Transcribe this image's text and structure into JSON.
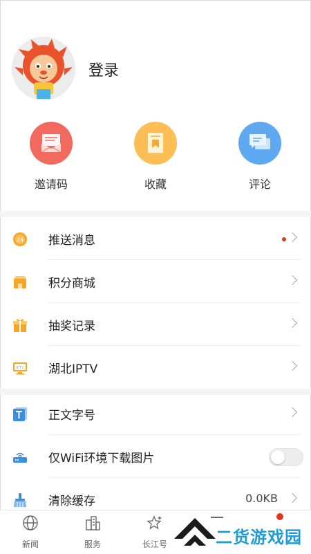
{
  "profile": {
    "login_label": "登录"
  },
  "shortcuts": [
    {
      "label": "邀请码",
      "icon": "envelope-icon",
      "color": "#f26a5e"
    },
    {
      "label": "收藏",
      "icon": "bookmark-icon",
      "color": "#fdbf55"
    },
    {
      "label": "评论",
      "icon": "comment-icon",
      "color": "#5fa9f2"
    }
  ],
  "menu": [
    {
      "label": "推送消息",
      "icon": "push-24-icon",
      "has_dot": true
    },
    {
      "label": "积分商城",
      "icon": "shop-icon"
    },
    {
      "label": "抽奖记录",
      "icon": "gift-icon"
    },
    {
      "label": "湖北IPTV",
      "icon": "iptv-icon"
    }
  ],
  "settings": [
    {
      "label": "正文字号",
      "icon": "font-size-icon"
    },
    {
      "label": "仅WiFi环境下载图片",
      "icon": "router-icon",
      "toggle": false
    },
    {
      "label": "清除缓存",
      "icon": "broom-icon",
      "value": "0.0KB"
    }
  ],
  "tabs": [
    {
      "label": "新闻",
      "icon": "globe-icon"
    },
    {
      "label": "服务",
      "icon": "building-icon"
    },
    {
      "label": "长江号",
      "icon": "star-icon"
    }
  ],
  "watermark": {
    "text": "二货游戏园"
  },
  "colors": {
    "accent_red": "#e0361c",
    "icon_orange": "#f6a623",
    "icon_blue": "#3b8ee0"
  }
}
